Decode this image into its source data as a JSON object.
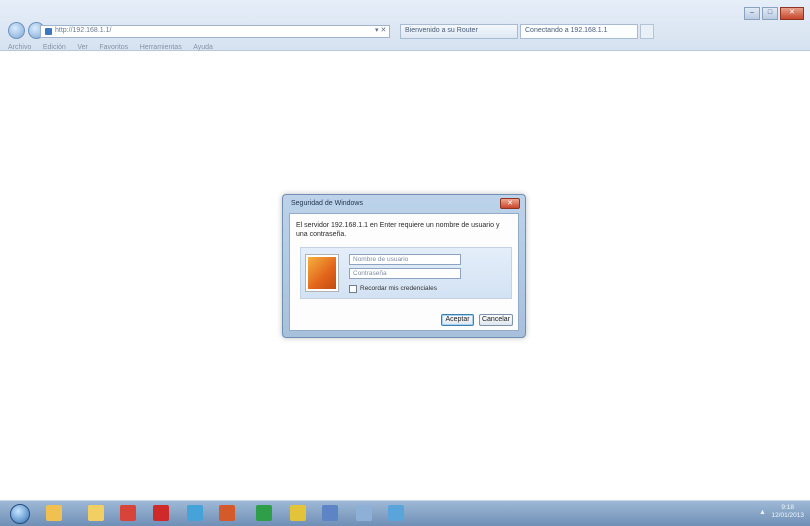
{
  "browser": {
    "address_text": "http://192.168.1.1/",
    "address_buttons": "▾ ✕",
    "tabs": [
      {
        "label": "Bienvenido a su Router"
      },
      {
        "label": "Conectando a 192.168.1.1"
      }
    ],
    "new_tab_label": "",
    "window_controls": {
      "minimize": "–",
      "maximize": "□",
      "close": "✕"
    },
    "menu": [
      "Archivo",
      "Edición",
      "Ver",
      "Favoritos",
      "Herramientas",
      "Ayuda"
    ]
  },
  "dialog": {
    "title": "Seguridad de Windows",
    "close_label": "✕",
    "message": "El servidor 192.168.1.1 en Enter requiere un nombre de usuario y una contraseña.",
    "username_placeholder": "Nombre de usuario",
    "password_placeholder": "Contraseña",
    "remember_label": "Recordar mis credenciales",
    "accept_label": "Aceptar",
    "cancel_label": "Cancelar"
  },
  "taskbar": {
    "icons": [
      {
        "name": "windows-explorer-icon",
        "color": "#f0c050"
      },
      {
        "name": "folder-icon",
        "color": "#f2cf63"
      },
      {
        "name": "chrome-icon",
        "color": "#d9443a"
      },
      {
        "name": "opera-icon",
        "color": "#cf2a2a"
      },
      {
        "name": "globe-icon",
        "color": "#46a3d9"
      },
      {
        "name": "user-icon",
        "color": "#d55a2a"
      },
      {
        "name": "green-app-icon",
        "color": "#2f9e48"
      },
      {
        "name": "note-icon",
        "color": "#e3c33a"
      },
      {
        "name": "mail-icon",
        "color": "#5d84c4"
      },
      {
        "name": "search-icon",
        "color": "#8fb0d6"
      },
      {
        "name": "browser-icon",
        "color": "#5aa4dc"
      }
    ],
    "clock_time": "9:18",
    "clock_date": "12/01/2013"
  },
  "colors": {
    "chrome_bg": "#d6e2f0",
    "dialog_frame": "#a7c0dc",
    "taskbar_bg": "#6f8fb6"
  }
}
